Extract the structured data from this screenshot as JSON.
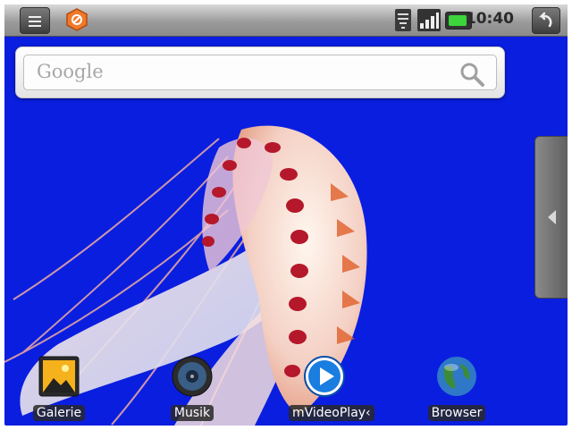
{
  "status_bar": {
    "time": "10:40",
    "icons": [
      "menu-icon",
      "notification-app-icon",
      "wifi-icon",
      "signal-icon",
      "battery-icon",
      "back-icon"
    ]
  },
  "search": {
    "placeholder": "Google",
    "icon": "search-icon"
  },
  "wallpaper": {
    "subject": "jellyfish",
    "background_color": "#0a1ee0"
  },
  "dock": [
    {
      "label": "Galerie",
      "icon": "gallery-icon"
    },
    {
      "label": "Musik",
      "icon": "music-icon"
    },
    {
      "label": "mVideoPlay‹",
      "icon": "video-player-icon"
    },
    {
      "label": "Browser",
      "icon": "browser-icon"
    }
  ]
}
